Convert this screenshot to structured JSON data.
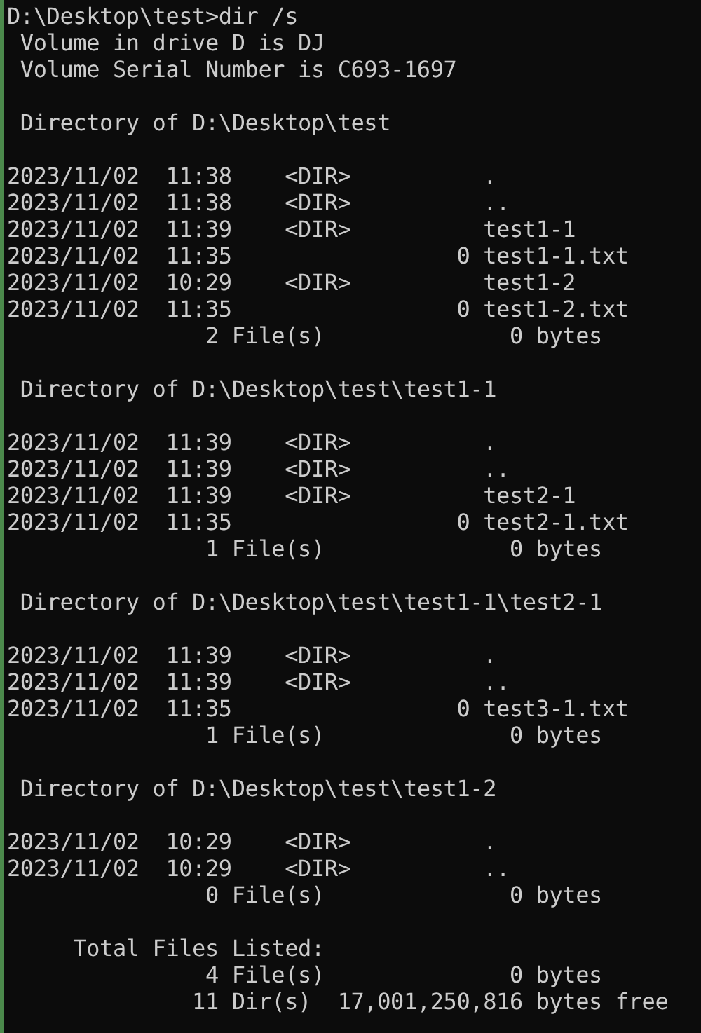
{
  "console": {
    "command_line": "D:\\Desktop\\test>dir /s",
    "volume_info": [
      " Volume in drive D is DJ",
      " Volume Serial Number is C693-1697"
    ],
    "directories": [
      {
        "heading": " Directory of D:\\Desktop\\test",
        "entries": [
          "2023/11/02  11:38    <DIR>          .",
          "2023/11/02  11:38    <DIR>          ..",
          "2023/11/02  11:39    <DIR>          test1-1",
          "2023/11/02  11:35                 0 test1-1.txt",
          "2023/11/02  10:29    <DIR>          test1-2",
          "2023/11/02  11:35                 0 test1-2.txt"
        ],
        "summary": "               2 File(s)              0 bytes"
      },
      {
        "heading": " Directory of D:\\Desktop\\test\\test1-1",
        "entries": [
          "2023/11/02  11:39    <DIR>          .",
          "2023/11/02  11:39    <DIR>          ..",
          "2023/11/02  11:39    <DIR>          test2-1",
          "2023/11/02  11:35                 0 test2-1.txt"
        ],
        "summary": "               1 File(s)              0 bytes"
      },
      {
        "heading": " Directory of D:\\Desktop\\test\\test1-1\\test2-1",
        "entries": [
          "2023/11/02  11:39    <DIR>          .",
          "2023/11/02  11:39    <DIR>          ..",
          "2023/11/02  11:35                 0 test3-1.txt"
        ],
        "summary": "               1 File(s)              0 bytes"
      },
      {
        "heading": " Directory of D:\\Desktop\\test\\test1-2",
        "entries": [
          "2023/11/02  10:29    <DIR>          .",
          "2023/11/02  10:29    <DIR>          .."
        ],
        "summary": "               0 File(s)              0 bytes"
      }
    ],
    "total": {
      "heading": "     Total Files Listed:",
      "lines": [
        "               4 File(s)              0 bytes",
        "              11 Dir(s)  17,001,250,816 bytes free"
      ]
    }
  }
}
